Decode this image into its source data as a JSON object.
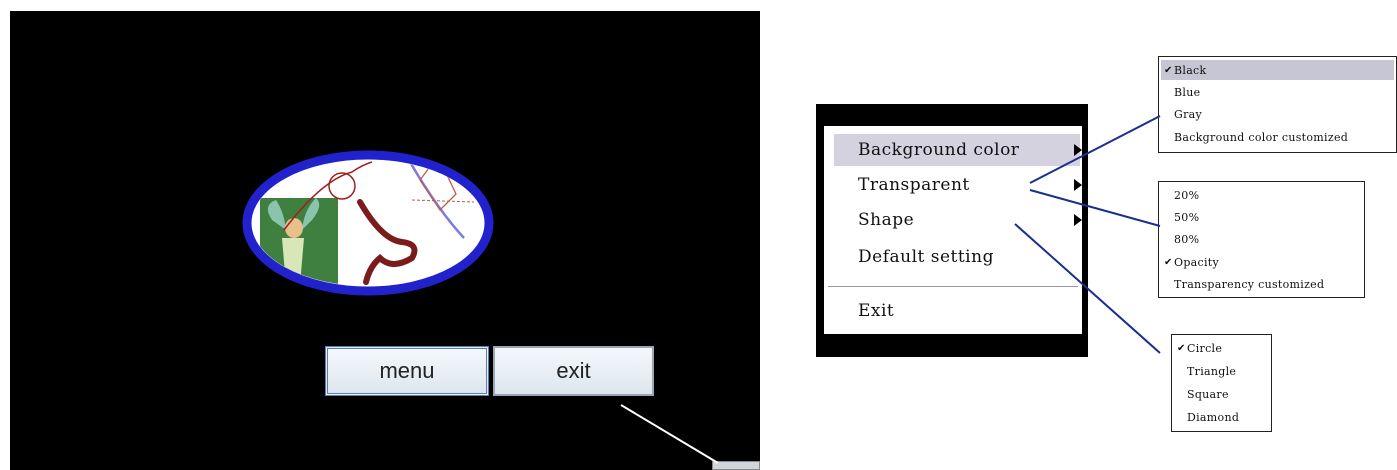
{
  "app": {
    "buttons": {
      "menu": "menu",
      "exit": "exit"
    }
  },
  "context_menu": {
    "items": [
      {
        "label": "Background color",
        "has_submenu": true,
        "highlighted": true
      },
      {
        "label": "Transparent",
        "has_submenu": true,
        "highlighted": false
      },
      {
        "label": "Shape",
        "has_submenu": true,
        "highlighted": false
      },
      {
        "label": "Default setting",
        "has_submenu": false,
        "highlighted": false
      }
    ],
    "exit": "Exit"
  },
  "submenus": {
    "background_color": {
      "items": [
        "Black",
        "Blue",
        "Gray",
        "Background color customized"
      ],
      "checked": "Black"
    },
    "transparent": {
      "items": [
        "20%",
        "50%",
        "80%",
        "Opacity",
        "Transparency customized"
      ],
      "checked": "Opacity"
    },
    "shape": {
      "items": [
        "Circle",
        "Triangle",
        "Square",
        "Diamond"
      ],
      "checked": "Circle"
    }
  },
  "colors": {
    "screen_bg": "#000000",
    "oval_border": "#2222cc",
    "connector_line": "#1c2f8c",
    "pointer_line": "#ffffff",
    "highlight": "#d3d2de"
  },
  "icons": {
    "check": "check-icon",
    "submenu_arrow": "triangle-right-icon"
  }
}
